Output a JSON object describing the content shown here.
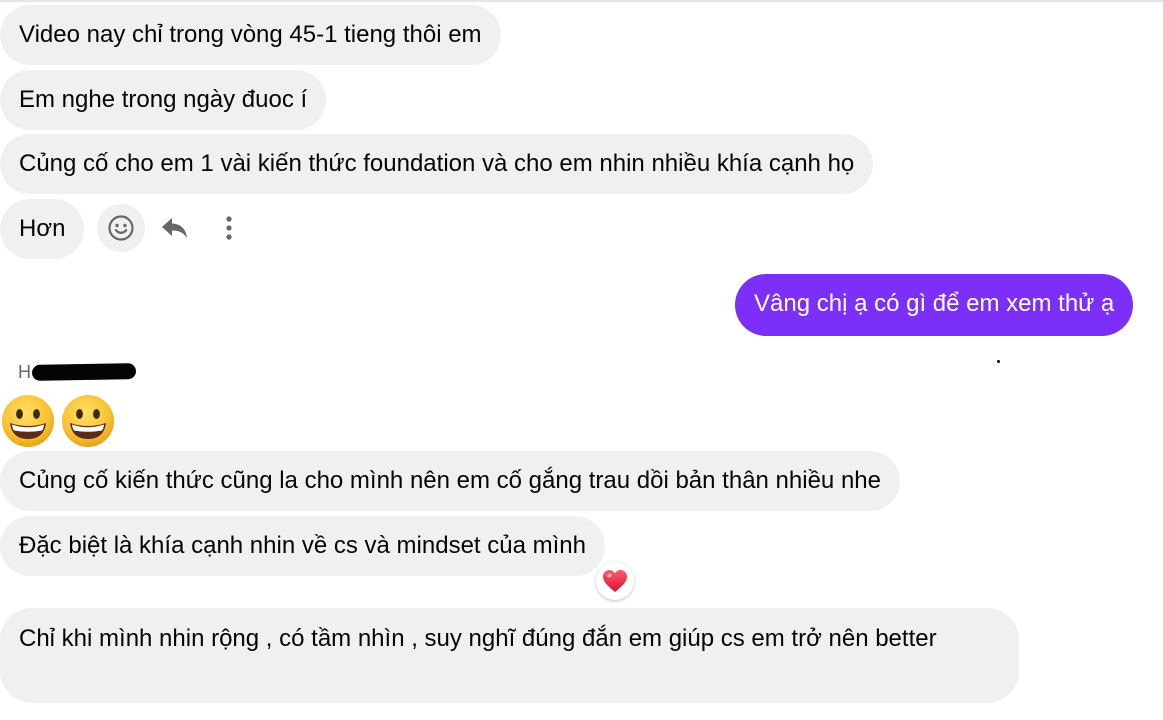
{
  "conversation": {
    "messages": [
      {
        "id": "m1",
        "direction": "incoming",
        "text": "Video nay chỉ trong vòng 45-1 tieng thôi em"
      },
      {
        "id": "m2",
        "direction": "incoming",
        "text": "Em nghe trong ngày đuoc í"
      },
      {
        "id": "m3",
        "direction": "incoming",
        "text": "Củng cố cho em 1 vài kiến thức foundation và cho em nhin nhiều khía cạnh họ"
      },
      {
        "id": "m4",
        "direction": "incoming",
        "text": "Hơn"
      },
      {
        "id": "m5",
        "direction": "outgoing",
        "text": "Vâng chị ạ có gì để em xem thử ạ"
      },
      {
        "id": "m6",
        "direction": "incoming",
        "text": "😀😀"
      },
      {
        "id": "m7",
        "direction": "incoming",
        "text": "Củng cố kiến thức cũng la cho mình nên em cố gắng trau dồi bản thân nhiều nhe"
      },
      {
        "id": "m8",
        "direction": "incoming",
        "text": "Đặc biệt là khía cạnh nhin về cs và mindset của mình",
        "reaction": "heart"
      },
      {
        "id": "m9",
        "direction": "incoming",
        "text": "Chỉ khi mình nhin rộng , có tầm nhìn , suy nghĩ đúng đắn em giúp cs em trở nên better"
      }
    ],
    "sender_name_visible": "H",
    "sender_name_redacted": true
  },
  "message_actions": {
    "icons": [
      "smiley-react-icon",
      "reply-icon",
      "more-options-icon"
    ]
  },
  "colors": {
    "incoming_bubble": "#f0f0f0",
    "outgoing_bubble": "#7b2ff7",
    "text": "#050505",
    "secondary_text": "#65676b",
    "heart": "#e41e3f"
  }
}
